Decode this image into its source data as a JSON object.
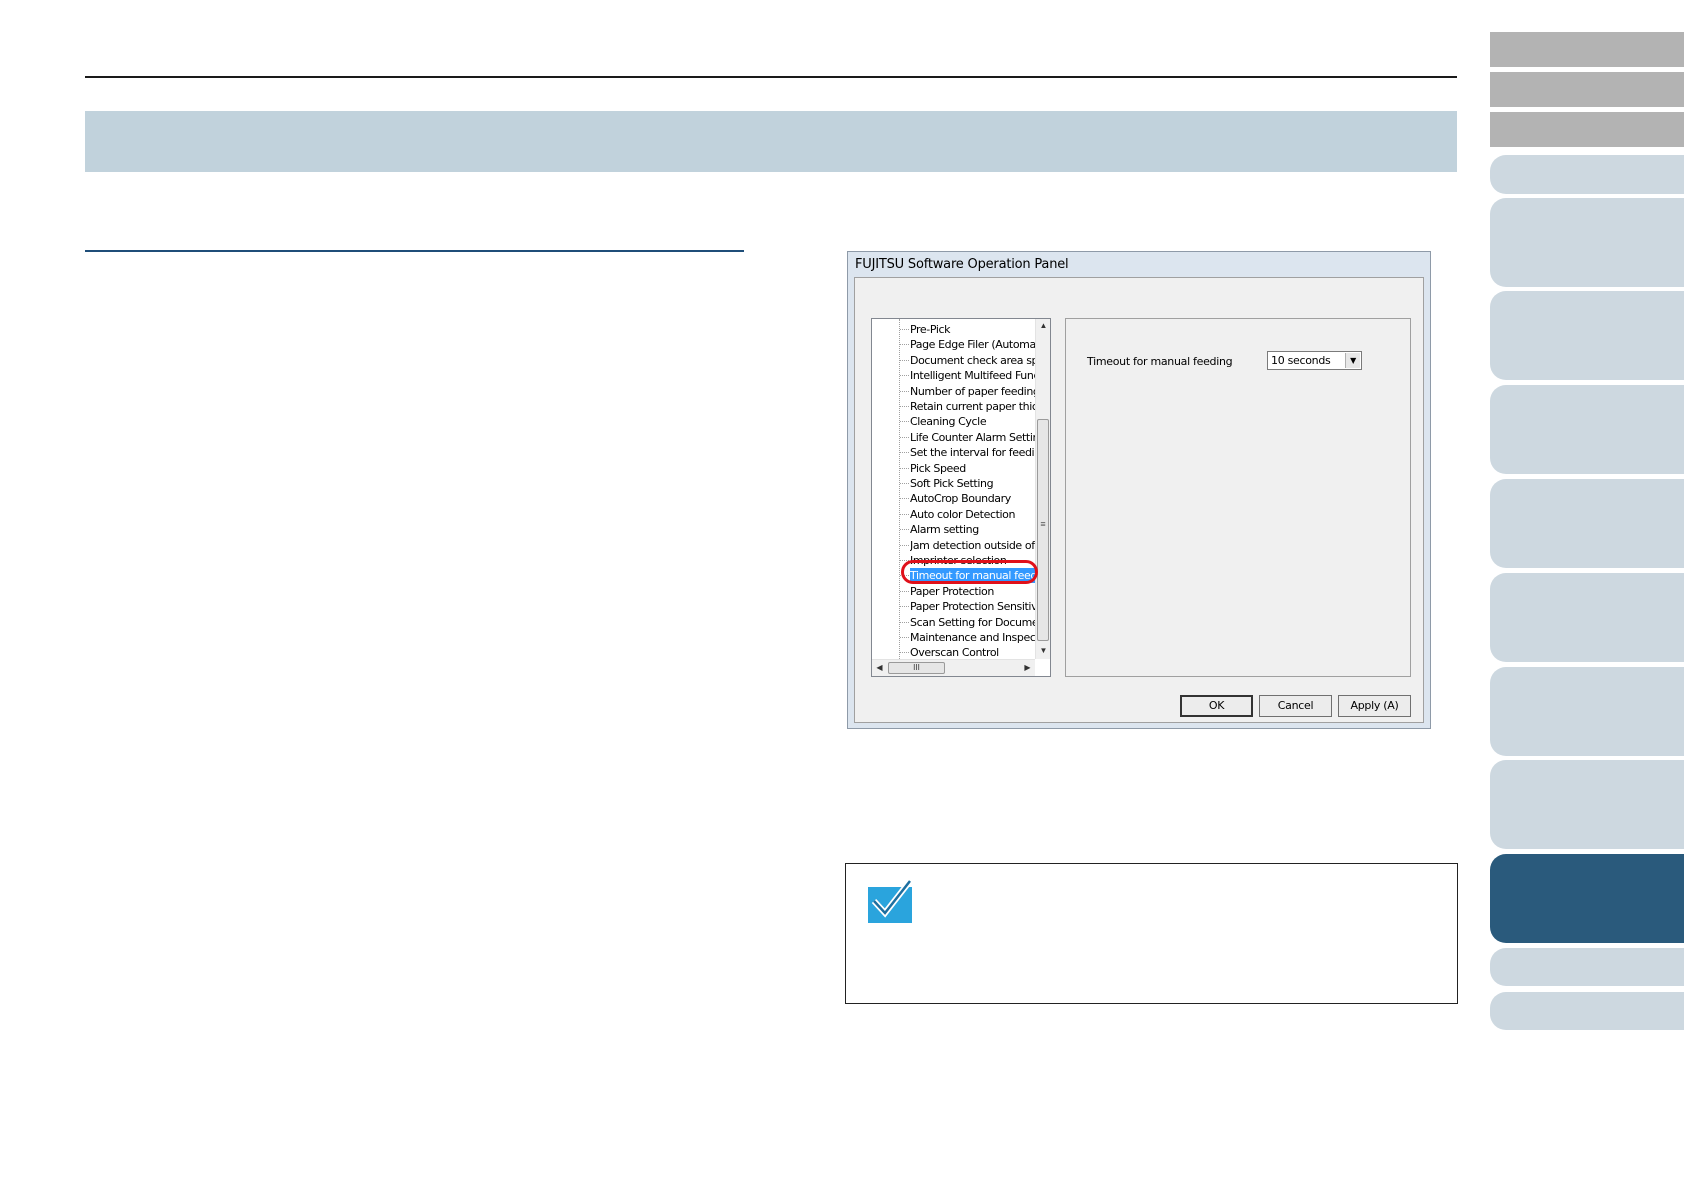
{
  "side_tabs": [
    {
      "style": "gray"
    },
    {
      "style": "gray"
    },
    {
      "style": "gray"
    },
    {
      "style": "light"
    },
    {
      "style": "light"
    },
    {
      "style": "light"
    },
    {
      "style": "light"
    },
    {
      "style": "light"
    },
    {
      "style": "light"
    },
    {
      "style": "light"
    },
    {
      "style": "light"
    },
    {
      "style": "active"
    },
    {
      "style": "light"
    },
    {
      "style": "light"
    }
  ],
  "dialog": {
    "title": "FUJITSU Software Operation Panel",
    "tree_items": [
      "Pre-Pick",
      "Page Edge Filer (Automatic",
      "Document check area spe",
      "Intelligent Multifeed Functio",
      "Number of paper feeding re",
      "Retain current paper thickr",
      "Cleaning Cycle",
      "Life Counter Alarm Setting",
      "Set the interval for feeding",
      "Pick Speed",
      "Soft Pick Setting",
      "AutoCrop Boundary",
      "Auto color Detection",
      "Alarm setting",
      "Jam detection outside of sc",
      "Imprinter selection",
      "Timeout for manual feeding",
      "Paper Protection",
      "Paper Protection Sensitivity",
      "Scan Setting for Document",
      "Maintenance and Inspectic",
      "Overscan Control"
    ],
    "selected_index": 16,
    "scroll_glyphs": {
      "up": "▲",
      "down": "▼",
      "left": "◀",
      "right": "▶",
      "grip_v": "≡",
      "grip_h": "III"
    },
    "field_label": "Timeout for manual feeding",
    "field_value": "10 seconds",
    "combo_arrow": "▼",
    "buttons": {
      "ok": "OK",
      "cancel": "Cancel",
      "apply": "Apply (A)"
    }
  },
  "colors": {
    "title_band": "#c1d2dc",
    "section_rule": "#1f4e79",
    "tab_active": "#2a5a7c",
    "tab_light": "#cdd8e0",
    "tab_gray": "#b3b3b3",
    "highlight_ring": "#e0101a",
    "selection": "#3399ff",
    "check_icon": "#2aa4dd"
  },
  "icons": {
    "hint": "checkmark-icon"
  }
}
